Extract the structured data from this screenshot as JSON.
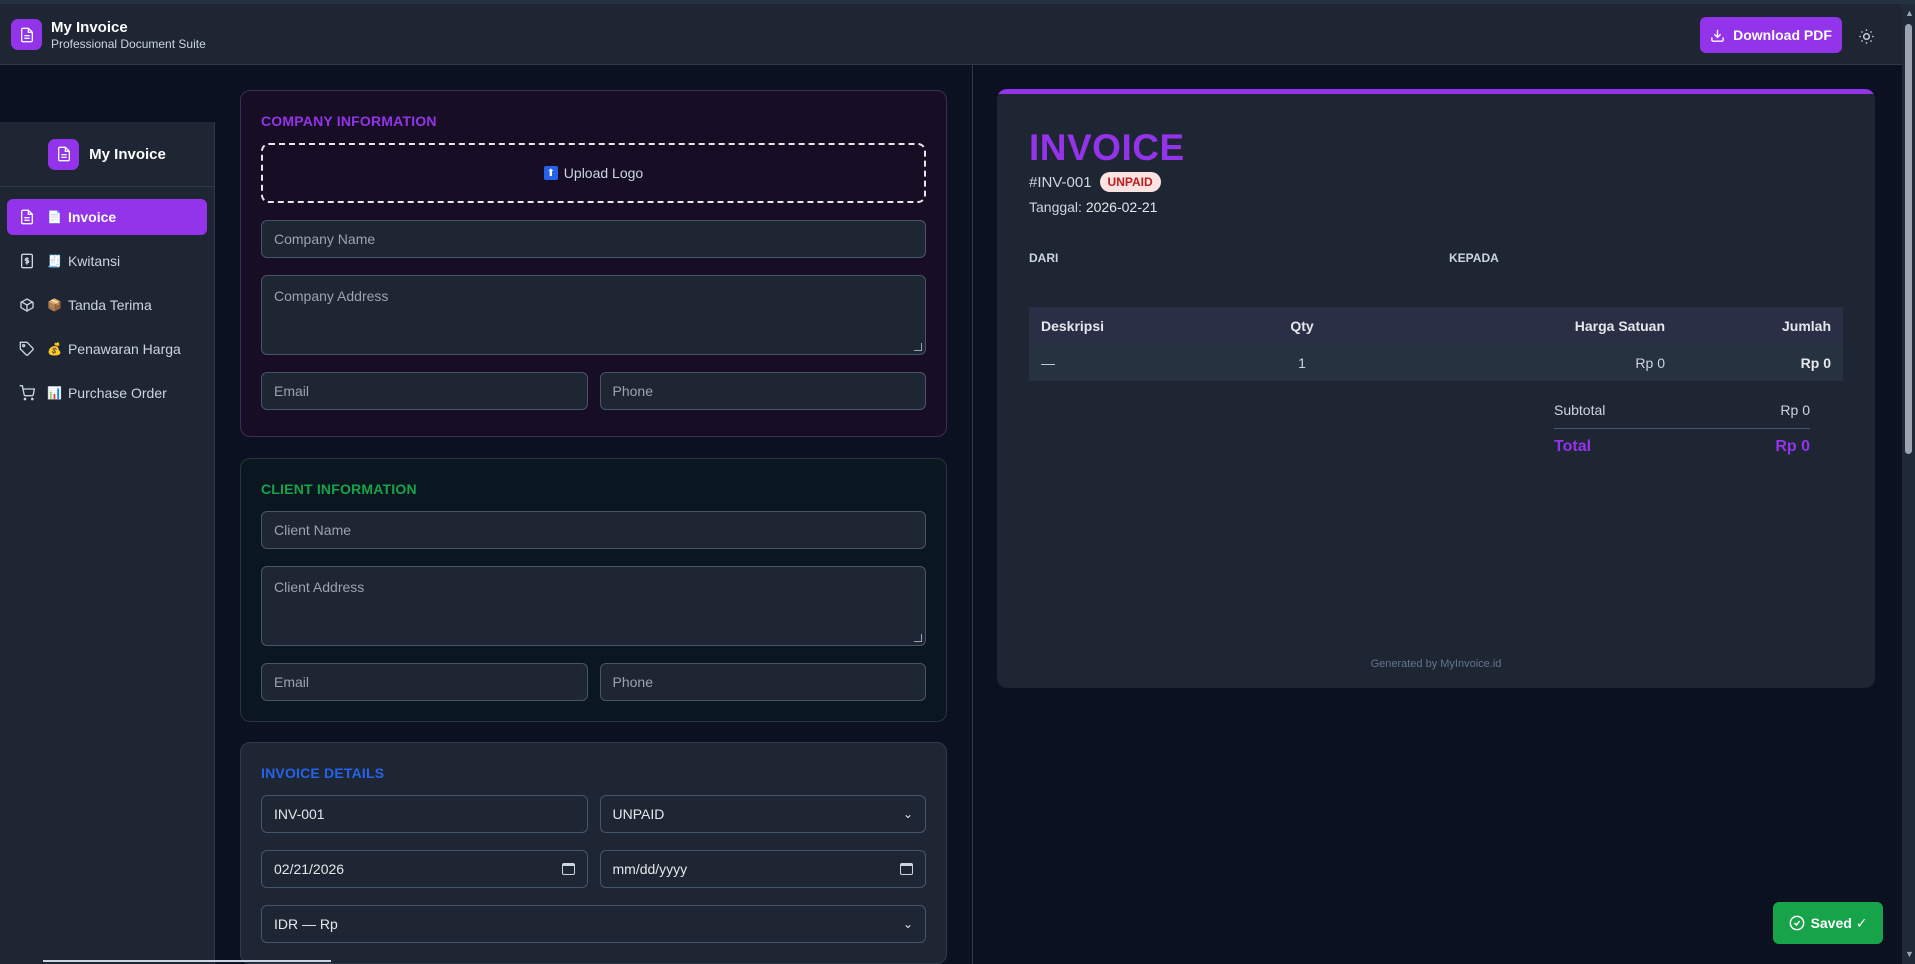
{
  "header": {
    "title": "My Invoice",
    "subtitle": "Professional Document Suite",
    "download_label": "Download PDF"
  },
  "sidebar": {
    "title": "My Invoice",
    "items": [
      {
        "label": "Invoice",
        "emoji": "📄"
      },
      {
        "label": "Kwitansi",
        "emoji": "🧾"
      },
      {
        "label": "Tanda Terima",
        "emoji": "📦"
      },
      {
        "label": "Penawaran Harga",
        "emoji": "💰"
      },
      {
        "label": "Purchase Order",
        "emoji": "📊"
      }
    ]
  },
  "company": {
    "title": "COMPANY INFORMATION",
    "upload_label": "Upload Logo",
    "name_placeholder": "Company Name",
    "address_placeholder": "Company Address",
    "email_placeholder": "Email",
    "phone_placeholder": "Phone",
    "title_color": "#9333ea"
  },
  "client": {
    "title": "CLIENT INFORMATION",
    "name_placeholder": "Client Name",
    "address_placeholder": "Client Address",
    "email_placeholder": "Email",
    "phone_placeholder": "Phone",
    "title_color": "#16a34a"
  },
  "details": {
    "title": "INVOICE DETAILS",
    "invoice_number": "INV-001",
    "status": "UNPAID",
    "date": "02/21/2026",
    "due_date_placeholder": "mm/dd/yyyy",
    "currency": "IDR — Rp",
    "title_color": "#2563eb"
  },
  "preview": {
    "title": "INVOICE",
    "number": "#INV-001",
    "status_badge": "UNPAID",
    "date_label": "Tanggal:",
    "date_value": "2026-02-21",
    "from_label": "DARI",
    "to_label": "KEPADA",
    "table": {
      "headers": [
        "Deskripsi",
        "Qty",
        "Harga Satuan",
        "Jumlah"
      ],
      "rows": [
        [
          "—",
          "1",
          "Rp 0",
          "Rp 0"
        ]
      ]
    },
    "subtotal_label": "Subtotal",
    "subtotal_value": "Rp 0",
    "total_label": "Total",
    "total_value": "Rp 0",
    "footer": "Generated by MyInvoice.id"
  },
  "toast": {
    "label": "Saved ✓"
  },
  "colors": {
    "accent": "#9333ea",
    "success": "#16a34a"
  }
}
